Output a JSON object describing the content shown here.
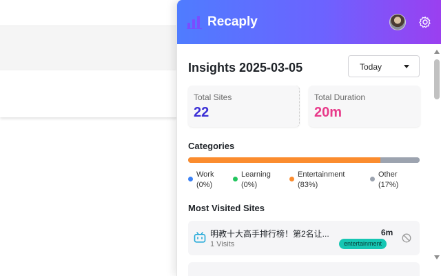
{
  "app": {
    "name": "Recaply",
    "brand_color_start": "#4f7cff",
    "brand_color_end": "#9b3ff0"
  },
  "header": {
    "logo_icon": "bar-chart-icon",
    "avatar_icon": "user-avatar",
    "settings_icon": "gear-icon"
  },
  "insights": {
    "title": "Insights 2025-03-05",
    "range_selected": "Today"
  },
  "stats": {
    "total_sites_label": "Total Sites",
    "total_sites_value": "22",
    "total_duration_label": "Total Duration",
    "total_duration_value": "20m"
  },
  "categories": {
    "title": "Categories",
    "items": [
      {
        "name": "Work",
        "percent_text": "(0%)",
        "percent": 0,
        "color": "#3b82f6"
      },
      {
        "name": "Learning",
        "percent_text": "(0%)",
        "percent": 0,
        "color": "#22c55e"
      },
      {
        "name": "Entertainment",
        "percent_text": "(83%)",
        "percent": 83,
        "color": "#fb8c2e"
      },
      {
        "name": "Other",
        "percent_text": "(17%)",
        "percent": 17,
        "color": "#9ca3af"
      }
    ]
  },
  "most_visited": {
    "title": "Most Visited Sites",
    "sites": [
      {
        "title": "明教十大高手排行榜！第2名让...",
        "visits": "1 Visits",
        "duration": "6m",
        "category": "entertainment",
        "icon": "bilibili-tv-icon"
      }
    ]
  }
}
